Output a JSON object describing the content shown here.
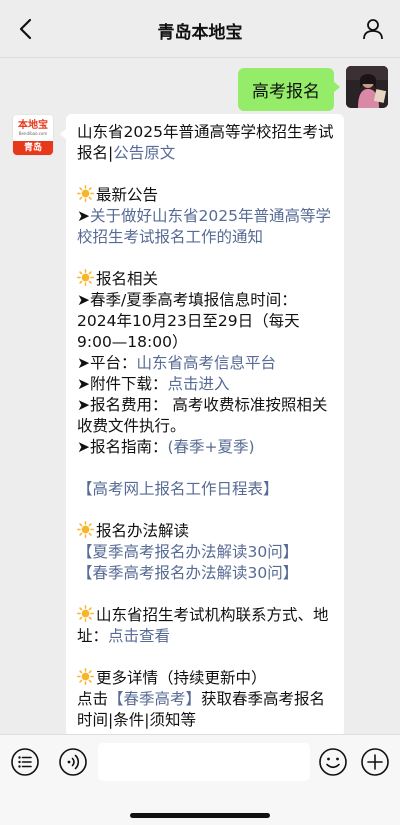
{
  "header": {
    "title": "青岛本地宝",
    "back_icon": "chevron-left-icon",
    "profile_icon": "person-icon"
  },
  "messages": {
    "user": {
      "text": "高考报名"
    },
    "bot": {
      "avatar": {
        "brand": "本地宝",
        "url": "Bendibao.com",
        "city": "青岛"
      },
      "heading_text": "山东省2025年普通高等学校招生考试报名|",
      "heading_link": "公告原文",
      "sec1_title": "最新公告",
      "sec1_arrow": "➤",
      "sec1_link": "关于做好山东省2025年普通高等学校招生考试报名工作的通知",
      "sec2_title": "报名相关",
      "sec2_line1": "➤春季/夏季高考填报信息时间：2024年10月23日至29日（每天9:00—18:00）",
      "sec2_line2_label": "➤平台：",
      "sec2_line2_link": "山东省高考信息平台",
      "sec2_line3_label": "➤附件下载：",
      "sec2_line3_link": "点击进入",
      "sec2_line4": "➤报名费用： 高考收费标准按照相关收费文件执行。",
      "sec2_line5_label": "➤报名指南：",
      "sec2_line5_link": "(春季+夏季)",
      "schedule_link": "【高考网上报名工作日程表】",
      "sec3_title": "报名办法解读",
      "sec3_link1": "【夏季高考报名办法解读30问】",
      "sec3_link2": "【春季高考报名办法解读30问】",
      "sec4_title": "山东省招生考试机构联系方式、地址：",
      "sec4_link": "点击查看",
      "sec5_title": "更多详情（持续更新中）",
      "sec5_pre": "点击",
      "sec5_link": "【春季高考】",
      "sec5_post": "获取春季高考报名时间|条件|须知等",
      "colors": {
        "link": "#576b95",
        "my_bubble": "#95ec69",
        "sun": "#f7b52c"
      }
    }
  },
  "input_bar": {
    "left_icon": "menu-list-icon",
    "voice_icon": "voice-icon",
    "emoji_icon": "emoji-icon",
    "plus_icon": "plus-icon",
    "placeholder": ""
  }
}
